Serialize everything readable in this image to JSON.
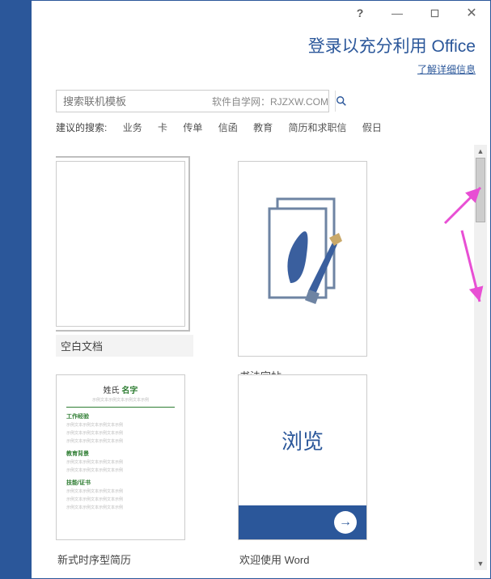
{
  "titlebar": {
    "help": "?",
    "minimize": "—",
    "close": "✕"
  },
  "header": {
    "title": "登录以充分利用 Office",
    "link": "了解详细信息"
  },
  "search": {
    "placeholder": "搜索联机模板",
    "watermark": "软件自学网：RJZXW.COM"
  },
  "suggestions": {
    "label": "建议的搜索:",
    "items": [
      "业务",
      "卡",
      "传单",
      "信函",
      "教育",
      "简历和求职信",
      "假日"
    ]
  },
  "templates": [
    {
      "label": "空白文档",
      "kind": "blank",
      "selected": true
    },
    {
      "label": "书法字帖",
      "kind": "calligraphy",
      "selected": false
    },
    {
      "label": "新式时序型简历",
      "kind": "resume",
      "selected": false
    },
    {
      "label": "欢迎使用 Word",
      "kind": "browse",
      "selected": false
    }
  ],
  "resume_thumb": {
    "name_surname": "姓氏",
    "name_given": "名字",
    "sec1": "工作经验",
    "sec2": "教育背景",
    "sec3": "技能/证书",
    "lorem": "示例文本示例文本示例文本示例"
  },
  "browse_thumb": {
    "title": "浏览",
    "arrow": "→"
  },
  "icons": {
    "search": "search"
  }
}
